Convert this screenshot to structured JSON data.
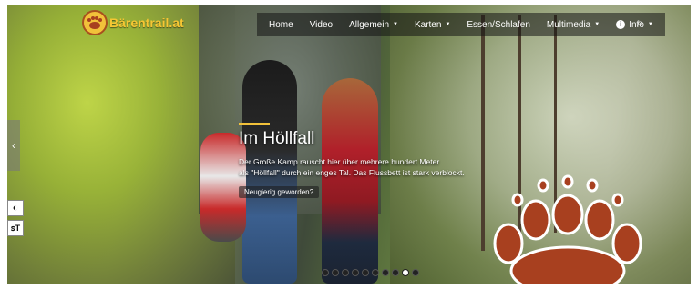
{
  "site": {
    "logo_text": "Bärentrail.at"
  },
  "nav": {
    "items": [
      {
        "label": "Home"
      },
      {
        "label": "Video"
      },
      {
        "label": "Allgemein",
        "caret": "▼"
      },
      {
        "label": "Karten",
        "caret": "▼"
      },
      {
        "label": "Essen/Schlafen"
      },
      {
        "label": "Multimedia",
        "caret": "▼"
      },
      {
        "label": "Info",
        "caret": "▼"
      }
    ],
    "info_icon": "i",
    "search_icon": "⌕"
  },
  "slider": {
    "prev_arrow": "‹",
    "title": "Im Höllfall",
    "text_line1": "Der Große Kamp rauscht hier über mehrere hundert Meter",
    "text_line2": "als \"Höllfall\" durch ein enges Tal. Das Flussbett ist stark verblockt.",
    "button_label": "Neugierig geworden?",
    "dot_count": 10,
    "active_dot": 8
  },
  "accessibility": {
    "contrast_icon": "◐",
    "textsize_icon": "ꜱT"
  },
  "colors": {
    "brand_yellow": "#f2c13a",
    "paw_brown": "#a8401f"
  }
}
